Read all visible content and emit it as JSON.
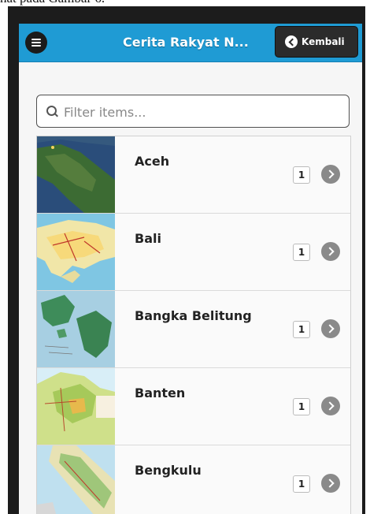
{
  "caption": "hat pada Gambar 6.",
  "header": {
    "title": "Cerita Rakyat N...",
    "back_label": "Kembali"
  },
  "filter": {
    "placeholder": "Filter items..."
  },
  "items": [
    {
      "label": "Aceh",
      "count": "1"
    },
    {
      "label": "Bali",
      "count": "1"
    },
    {
      "label": "Bangka Belitung",
      "count": "1"
    },
    {
      "label": "Banten",
      "count": "1"
    },
    {
      "label": "Bengkulu",
      "count": "1"
    }
  ],
  "icons": {
    "menu": "menu-icon",
    "back": "chevron-left-icon",
    "search": "search-icon",
    "row_arrow": "chevron-right-icon"
  },
  "colors": {
    "header": "#1f9bd4",
    "back_button": "#2b2b2b",
    "arrow": "#8a8a8a"
  }
}
